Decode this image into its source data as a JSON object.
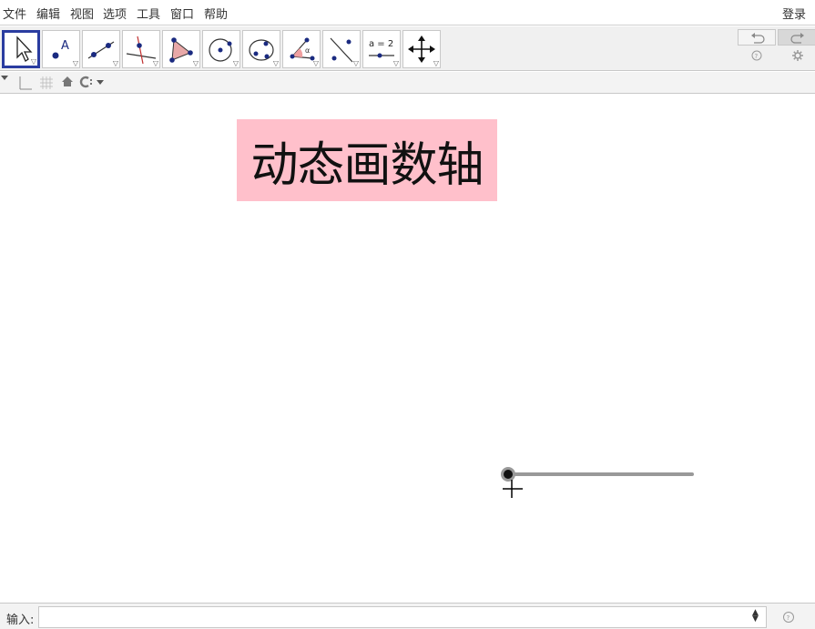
{
  "menubar": {
    "items": [
      {
        "label": "文件"
      },
      {
        "label": "编辑"
      },
      {
        "label": "视图"
      },
      {
        "label": "选项"
      },
      {
        "label": "工具"
      },
      {
        "label": "窗口"
      },
      {
        "label": "帮助"
      }
    ],
    "login_label": "登录"
  },
  "toolbar": {
    "tools": [
      {
        "icon": "move-arrow-icon",
        "selected": true
      },
      {
        "icon": "point-icon",
        "text": "A"
      },
      {
        "icon": "line-icon"
      },
      {
        "icon": "perpendicular-line-icon"
      },
      {
        "icon": "polygon-icon"
      },
      {
        "icon": "circle-center-point-icon"
      },
      {
        "icon": "conic-icon"
      },
      {
        "icon": "angle-icon",
        "text": "α"
      },
      {
        "icon": "reflect-icon"
      },
      {
        "icon": "slider-icon",
        "text": "a = 2"
      },
      {
        "icon": "move-graphics-view-icon"
      }
    ],
    "undo_icon": "undo-icon",
    "redo_icon": "redo-icon",
    "help_icon": "help-icon",
    "settings_icon": "gear-icon"
  },
  "stylebar": {
    "icons": [
      "toggle-stylebar-icon",
      "axes-icon",
      "grid-icon",
      "home-icon",
      "point-capture-icon"
    ]
  },
  "canvas": {
    "title": "动态画数轴",
    "title_background": "#ffc0cb",
    "slider_color": "#999999"
  },
  "inputbar": {
    "label": "输入:",
    "value": "",
    "help_icon": "help-icon"
  }
}
